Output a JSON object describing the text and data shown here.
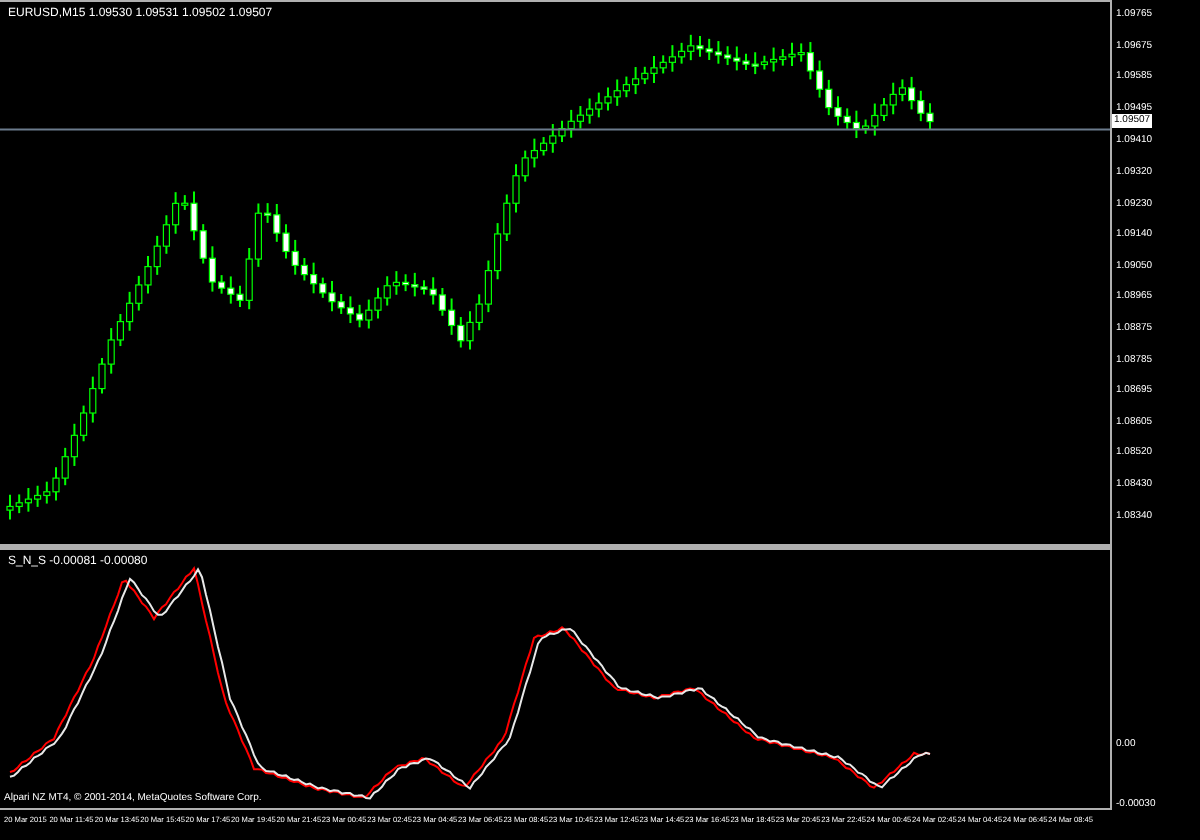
{
  "main_chart": {
    "title": "EURUSD,M15  1.09530 1.09531 1.09502 1.09507",
    "price_labels": [
      "1.09765",
      "1.09675",
      "1.09585",
      "1.09495",
      "1.09410",
      "1.09320",
      "1.09230",
      "1.09140",
      "1.09050",
      "1.08965",
      "1.08875",
      "1.08785",
      "1.08695",
      "1.08605",
      "1.08520",
      "1.08430",
      "1.08340"
    ],
    "current_price": "1.09507"
  },
  "indicator": {
    "label": "S_N_S -0.00081 -0.00080",
    "scale_labels": [
      "0.00",
      "-0.00030"
    ],
    "copyright": "Alpari NZ MT4, © 2001-2014, MetaQuotes Software Corp."
  },
  "time_labels": [
    "20 Mar 2015",
    "20 Mar 11:45",
    "20 Mar 13:45",
    "20 Mar 15:45",
    "20 Mar 17:45",
    "20 Mar 19:45",
    "20 Mar 21:45",
    "23 Mar 00:45",
    "23 Mar 02:45",
    "23 Mar 04:45",
    "23 Mar 06:45",
    "23 Mar 08:45",
    "23 Mar 10:45",
    "23 Mar 12:45",
    "23 Mar 14:45",
    "23 Mar 16:45",
    "23 Mar 18:45",
    "23 Mar 20:45",
    "23 Mar 22:45",
    "24 Mar 00:45",
    "24 Mar 02:45",
    "24 Mar 04:45",
    "24 Mar 06:45",
    "24 Mar 08:45"
  ]
}
